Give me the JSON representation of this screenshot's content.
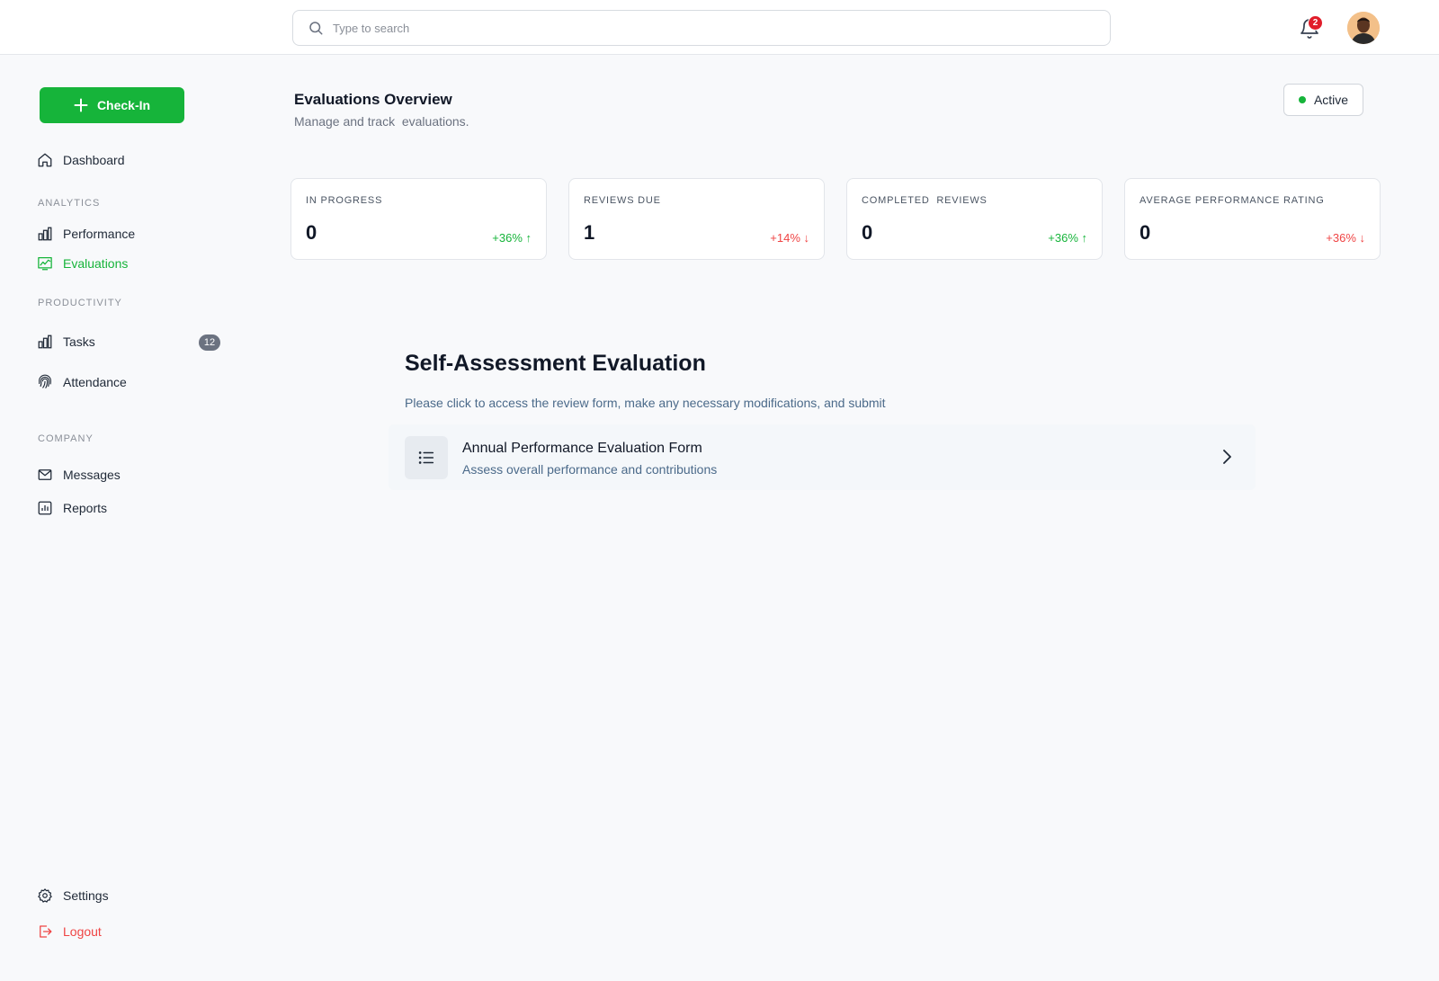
{
  "search": {
    "placeholder": "Type to search"
  },
  "notifications": {
    "count": "2"
  },
  "sidebar": {
    "checkin_label": "Check-In",
    "dashboard": "Dashboard",
    "sections": {
      "analytics": "ANALYTICS",
      "productivity": "PRODUCTIVITY",
      "company": "COMPANY"
    },
    "performance": "Performance",
    "evaluations": "Evaluations",
    "tasks": "Tasks",
    "tasks_badge": "12",
    "attendance": "Attendance",
    "messages": "Messages",
    "reports": "Reports",
    "settings": "Settings",
    "logout": "Logout"
  },
  "header": {
    "title": "Evaluations Overview",
    "subtitle": "Manage and track  evaluations.",
    "status_label": "Active"
  },
  "stats": [
    {
      "label": "IN PROGRESS",
      "value": "0",
      "change": "+36% ↑",
      "trend": "up"
    },
    {
      "label": "REVIEWS DUE",
      "value": "1",
      "change": "+14% ↓",
      "trend": "down"
    },
    {
      "label": "COMPLETED  REVIEWS",
      "value": "0",
      "change": "+36% ↑",
      "trend": "up"
    },
    {
      "label": "AVERAGE PERFORMANCE RATING",
      "value": "0",
      "change": "+36% ↓",
      "trend": "down"
    }
  ],
  "self_assessment": {
    "title": "Self-Assessment Evaluation",
    "description": "Please click to access the review form, make any necessary modifications, and submit",
    "form": {
      "title": "Annual Performance Evaluation Form",
      "subtitle": "Assess overall performance and contributions"
    }
  },
  "colors": {
    "accent": "#16b43a",
    "danger": "#ef4444",
    "muted": "#8a8f98"
  }
}
